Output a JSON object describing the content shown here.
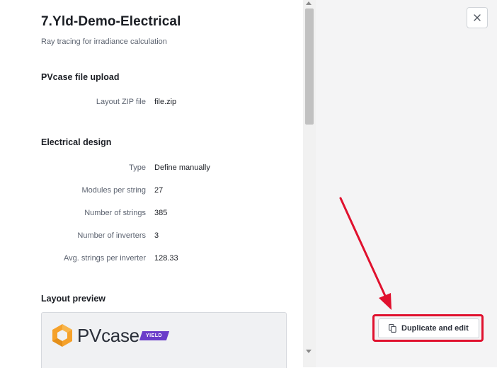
{
  "header": {
    "title": "7.Yld-Demo-Electrical",
    "subtitle": "Ray tracing for irradiance calculation"
  },
  "upload": {
    "heading": "PVcase file upload",
    "field_label": "Layout ZIP file",
    "field_value": "file.zip"
  },
  "electrical": {
    "heading": "Electrical design",
    "fields": [
      {
        "label": "Type",
        "value": "Define manually"
      },
      {
        "label": "Modules per string",
        "value": "27"
      },
      {
        "label": "Number of strings",
        "value": "385"
      },
      {
        "label": "Number of inverters",
        "value": "3"
      },
      {
        "label": "Avg. strings per inverter",
        "value": "128.33"
      }
    ]
  },
  "preview": {
    "heading": "Layout preview",
    "logo_text": "PVcase",
    "logo_badge": "YIELD"
  },
  "actions": {
    "duplicate_label": "Duplicate and edit",
    "close_icon": "close-icon",
    "duplicate_icon": "copy-icon"
  },
  "colors": {
    "highlight": "#e0112e",
    "logo_orange": "#f5a12a",
    "badge_purple": "#6a3cc9"
  }
}
